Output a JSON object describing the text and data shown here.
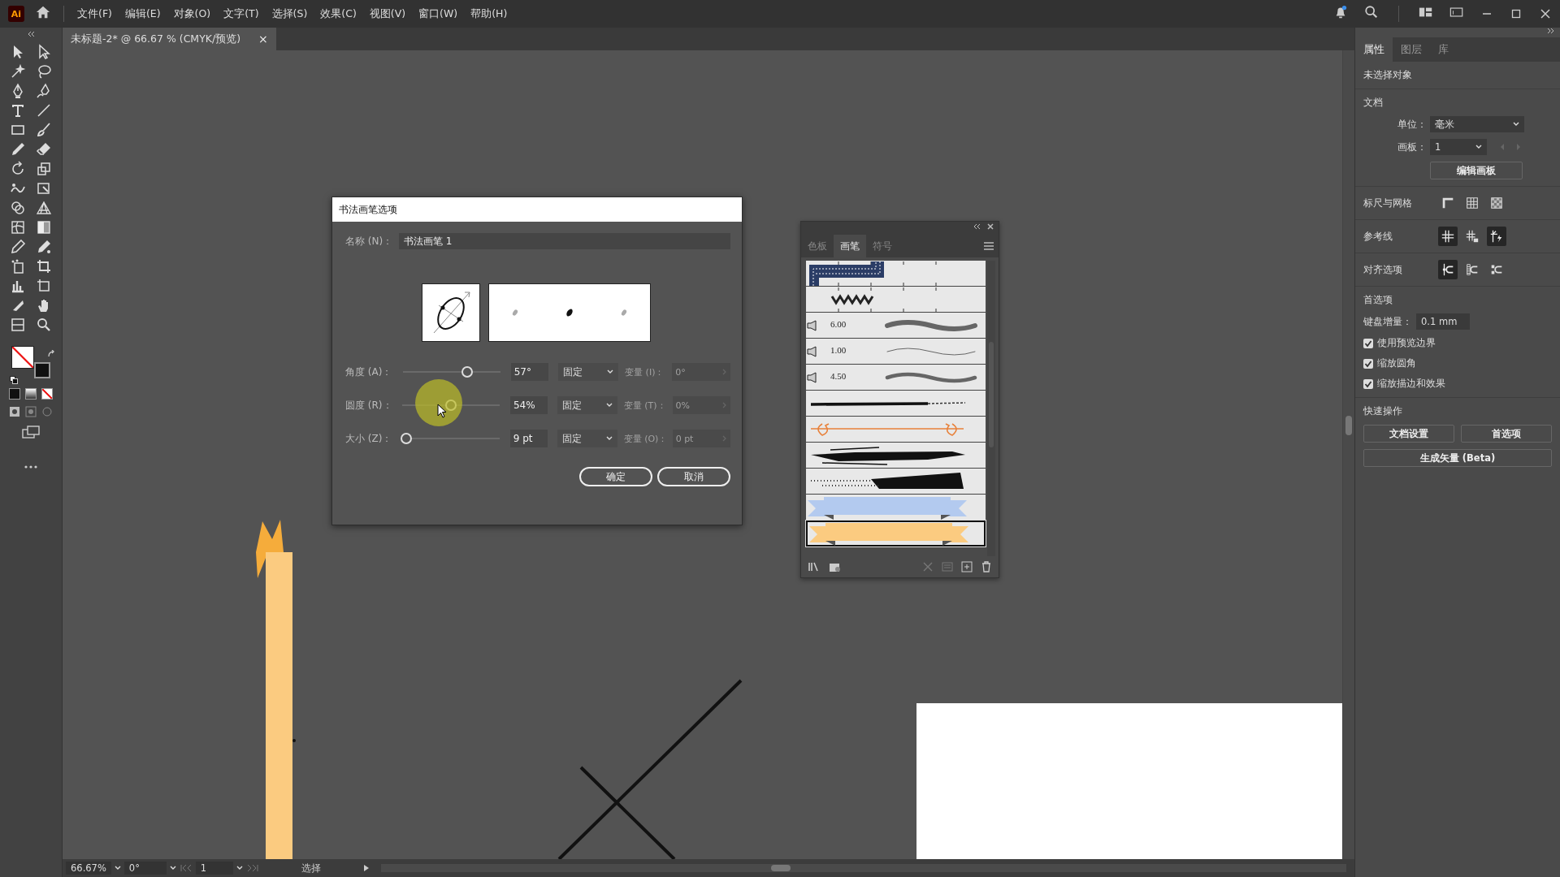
{
  "app": {
    "logo": "Ai"
  },
  "menu": [
    "文件(F)",
    "编辑(E)",
    "对象(O)",
    "文字(T)",
    "选择(S)",
    "效果(C)",
    "视图(V)",
    "窗口(W)",
    "帮助(H)"
  ],
  "document_tab": {
    "title": "未标题-2* @ 66.67 % (CMYK/预览)",
    "close": "×"
  },
  "dialog": {
    "title": "书法画笔选项",
    "name_label": "名称 (N)：",
    "name_value": "书法画笔 1",
    "rows": [
      {
        "label": "角度 (A)：",
        "level": 0.65,
        "value": "57°",
        "mode": "固定",
        "variation_label": "变量 (I)：",
        "variation_value": "0°",
        "disabled": true
      },
      {
        "label": "圆度 (R)：",
        "level": 0.5,
        "value": "54%",
        "mode": "固定",
        "variation_label": "变量 (T)：",
        "variation_value": "0%",
        "disabled": true
      },
      {
        "label": "大小 (Z)：",
        "level": 0.07,
        "value": "9 pt",
        "mode": "固定",
        "variation_label": "变量 (O)：",
        "variation_value": "0 pt",
        "disabled": true
      }
    ],
    "buttons": [
      "确定",
      "取消"
    ]
  },
  "brushes_panel": {
    "tabs": [
      {
        "label": "色板",
        "selected": false
      },
      {
        "label": "画笔",
        "selected": true
      },
      {
        "label": "符号",
        "selected": false
      }
    ],
    "brushes": [
      {
        "kind": "pattern",
        "selected": false
      },
      {
        "kind": "zigzag",
        "selected": false
      },
      {
        "kind": "bristle",
        "value": "6.00",
        "selected": false
      },
      {
        "kind": "bristle",
        "value": "1.00",
        "selected": false
      },
      {
        "kind": "bristle",
        "value": "4.50",
        "selected": false
      },
      {
        "kind": "charcoal",
        "selected": false
      },
      {
        "kind": "arrow",
        "color": "#e8813a",
        "selected": false
      },
      {
        "kind": "ink",
        "selected": false
      },
      {
        "kind": "grunge",
        "selected": false
      },
      {
        "kind": "ribbon",
        "color": "#b3caef",
        "selected": false
      },
      {
        "kind": "ribbon",
        "color": "#fbcb80",
        "selected": true
      }
    ]
  },
  "properties_panel": {
    "tabs": [
      {
        "label": "属性",
        "selected": true
      },
      {
        "label": "图层",
        "selected": false
      },
      {
        "label": "库",
        "selected": false
      }
    ],
    "status": "未选择对象",
    "document": {
      "heading": "文档",
      "unit_label": "单位：",
      "unit_value": "毫米",
      "artboard_label": "画板：",
      "artboard_value": "1",
      "edit_button": "编辑画板"
    },
    "toggle_groups": [
      {
        "heading": "标尺与网格",
        "toggles": [
          {
            "kind": "ruler",
            "on": false
          },
          {
            "kind": "grid",
            "on": false
          },
          {
            "kind": "transparency-grid",
            "on": false
          }
        ]
      },
      {
        "heading": "参考线",
        "toggles": [
          {
            "kind": "guides",
            "on": true
          },
          {
            "kind": "lock-guides",
            "on": false
          },
          {
            "kind": "smart-guides",
            "on": true
          }
        ]
      },
      {
        "heading": "对齐选项",
        "toggles": [
          {
            "kind": "snap-point",
            "on": true
          },
          {
            "kind": "snap-pixel",
            "on": false
          },
          {
            "kind": "snap-glyph",
            "on": false
          }
        ]
      }
    ],
    "preferences": {
      "heading": "首选项",
      "keyboard_label": "键盘增量：",
      "keyboard_value": "0.1 mm",
      "checkboxes": [
        {
          "label": "使用预览边界",
          "checked": true
        },
        {
          "label": "缩放圆角",
          "checked": true
        },
        {
          "label": "缩放描边和效果",
          "checked": true
        }
      ]
    },
    "quick_actions": {
      "heading": "快速操作",
      "buttons": [
        "文档设置",
        "首选项",
        "生成矢量 (Beta)"
      ]
    }
  },
  "status_bar": {
    "zoom": "66.67%",
    "rotation": "0°",
    "artboard": "1",
    "tool": "选择"
  }
}
